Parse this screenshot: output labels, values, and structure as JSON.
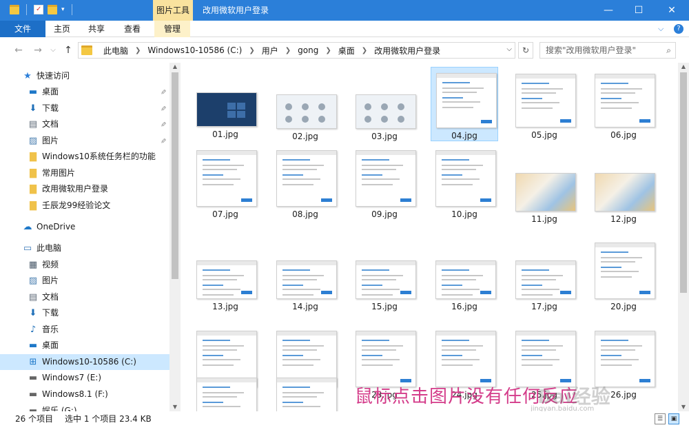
{
  "title_bar": {
    "context_tab": "图片工具",
    "window_title": "改用微软用户登录",
    "minimize": "—",
    "maximize": "☐",
    "close": "✕"
  },
  "ribbon": {
    "tabs": [
      "文件",
      "主页",
      "共享",
      "查看",
      "管理"
    ],
    "expand": "⌵",
    "help": "?"
  },
  "address": {
    "back": "←",
    "forward": "→",
    "history": "⌵",
    "up": "↑",
    "crumbs": [
      "此电脑",
      "Windows10-10586 (C:)",
      "用户",
      "gong",
      "桌面",
      "改用微软用户登录"
    ],
    "dropdown": "⌵",
    "refresh": "↻",
    "search_placeholder": "搜索\"改用微软用户登录\"",
    "search_icon": "⌕"
  },
  "sidebar": {
    "items": [
      {
        "label": "快速访问",
        "icon": "star-icon",
        "glyph": "★",
        "color": "#2b7fd9",
        "indent": 1,
        "pinned": false
      },
      {
        "label": "桌面",
        "icon": "desktop-icon",
        "glyph": "▬",
        "color": "#1e78c8",
        "indent": 2,
        "pinned": true
      },
      {
        "label": "下载",
        "icon": "download-icon",
        "glyph": "⬇",
        "color": "#1e6fb8",
        "indent": 2,
        "pinned": true
      },
      {
        "label": "文档",
        "icon": "document-icon",
        "glyph": "▤",
        "color": "#5f6b78",
        "indent": 2,
        "pinned": true
      },
      {
        "label": "图片",
        "icon": "pictures-icon",
        "glyph": "▨",
        "color": "#4a7fb0",
        "indent": 2,
        "pinned": true
      },
      {
        "label": "Windows10系统任务栏的功能",
        "icon": "folder-icon",
        "glyph": "▇",
        "color": "#f0c24a",
        "indent": 2,
        "pinned": false
      },
      {
        "label": "常用图片",
        "icon": "folder-icon",
        "glyph": "▇",
        "color": "#f0c24a",
        "indent": 2,
        "pinned": false
      },
      {
        "label": "改用微软用户登录",
        "icon": "folder-icon",
        "glyph": "▇",
        "color": "#f0c24a",
        "indent": 2,
        "pinned": false
      },
      {
        "label": "壬辰龙99经验论文",
        "icon": "folder-icon",
        "glyph": "▇",
        "color": "#f0c24a",
        "indent": 2,
        "pinned": false
      },
      {
        "label": "OneDrive",
        "icon": "cloud-icon",
        "glyph": "☁",
        "color": "#1e78c8",
        "indent": 1,
        "pinned": false
      },
      {
        "label": "此电脑",
        "icon": "computer-icon",
        "glyph": "▭",
        "color": "#3a78b8",
        "indent": 1,
        "pinned": false
      },
      {
        "label": "视频",
        "icon": "video-icon",
        "glyph": "▦",
        "color": "#4a5a6a",
        "indent": 2,
        "pinned": false
      },
      {
        "label": "图片",
        "icon": "pictures-icon",
        "glyph": "▨",
        "color": "#4a7fb0",
        "indent": 2,
        "pinned": false
      },
      {
        "label": "文档",
        "icon": "document-icon",
        "glyph": "▤",
        "color": "#5f6b78",
        "indent": 2,
        "pinned": false
      },
      {
        "label": "下载",
        "icon": "download-icon",
        "glyph": "⬇",
        "color": "#1e6fb8",
        "indent": 2,
        "pinned": false
      },
      {
        "label": "音乐",
        "icon": "music-icon",
        "glyph": "♪",
        "color": "#1e6fb8",
        "indent": 2,
        "pinned": false
      },
      {
        "label": "桌面",
        "icon": "desktop-icon",
        "glyph": "▬",
        "color": "#1e78c8",
        "indent": 2,
        "pinned": false
      },
      {
        "label": "Windows10-10586 (C:)",
        "icon": "windows-drive-icon",
        "glyph": "⊞",
        "color": "#1e78c8",
        "indent": 2,
        "pinned": false,
        "selected": true
      },
      {
        "label": "Windows7 (E:)",
        "icon": "drive-icon",
        "glyph": "▬",
        "color": "#666666",
        "indent": 2,
        "pinned": false
      },
      {
        "label": "Windows8.1 (F:)",
        "icon": "drive-icon",
        "glyph": "▬",
        "color": "#666666",
        "indent": 2,
        "pinned": false
      },
      {
        "label": "娱乐 (G:)",
        "icon": "drive-icon",
        "glyph": "▬",
        "color": "#666666",
        "indent": 2,
        "pinned": false
      }
    ],
    "pin_glyph": "📌"
  },
  "files": [
    {
      "name": "01.jpg",
      "style": "dark"
    },
    {
      "name": "02.jpg",
      "style": "light"
    },
    {
      "name": "03.jpg",
      "style": "light"
    },
    {
      "name": "04.jpg",
      "style": "form",
      "selected": true
    },
    {
      "name": "05.jpg",
      "style": "form"
    },
    {
      "name": "06.jpg",
      "style": "form"
    },
    {
      "name": "07.jpg",
      "style": "form"
    },
    {
      "name": "08.jpg",
      "style": "form"
    },
    {
      "name": "09.jpg",
      "style": "form"
    },
    {
      "name": "10.jpg",
      "style": "form"
    },
    {
      "name": "11.jpg",
      "style": "photo"
    },
    {
      "name": "12.jpg",
      "style": "photo"
    },
    {
      "name": "13.jpg",
      "style": "form"
    },
    {
      "name": "14.jpg",
      "style": "form"
    },
    {
      "name": "15.jpg",
      "style": "form"
    },
    {
      "name": "16.jpg",
      "style": "form"
    },
    {
      "name": "17.jpg",
      "style": "form"
    },
    {
      "name": "20.jpg",
      "style": "form"
    },
    {
      "name": "21.jpg",
      "style": "form"
    },
    {
      "name": "22.jpg",
      "style": "form"
    },
    {
      "name": "23.jpg",
      "style": "form"
    },
    {
      "name": "24.jpg",
      "style": "form"
    },
    {
      "name": "25.jpg",
      "style": "form"
    },
    {
      "name": "26.jpg",
      "style": "form"
    },
    {
      "name": "",
      "style": "form"
    },
    {
      "name": "",
      "style": "form"
    }
  ],
  "overlay_text": "鼠标点击图片没有任何反应",
  "watermark": "Bai经验",
  "watermark_url": "jingyan.baidu.com",
  "status": {
    "count": "26 个项目",
    "selection": "选中 1 个项目  23.4 KB"
  },
  "view_buttons": {
    "details": "☰",
    "large_icons": "▣"
  }
}
